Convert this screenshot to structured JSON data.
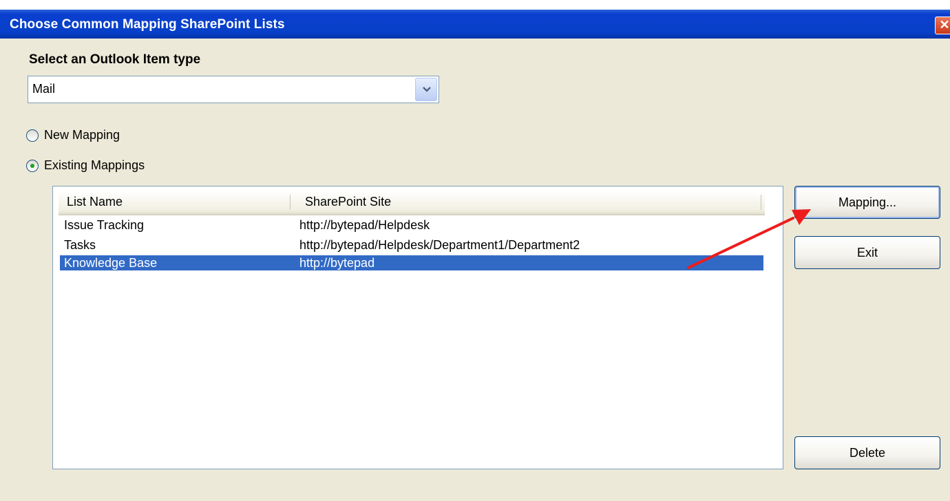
{
  "window": {
    "title": "Choose Common Mapping SharePoint Lists",
    "close_glyph": "✕"
  },
  "item_type": {
    "label": "Select an Outlook Item type",
    "selected": "Mail"
  },
  "radios": {
    "new_mapping": {
      "label": "New Mapping",
      "checked": false
    },
    "existing_mappings": {
      "label": "Existing Mappings",
      "checked": true
    }
  },
  "list": {
    "columns": [
      "List Name",
      "SharePoint Site"
    ],
    "rows": [
      {
        "name": "Issue Tracking",
        "site": "http://bytepad/Helpdesk",
        "selected": false
      },
      {
        "name": "Tasks",
        "site": "http://bytepad/Helpdesk/Department1/Department2",
        "selected": false
      },
      {
        "name": "Knowledge Base",
        "site": "http://bytepad",
        "selected": true
      }
    ]
  },
  "buttons": {
    "mapping": "Mapping...",
    "exit": "Exit",
    "delete": "Delete"
  },
  "colors": {
    "titlebar": "#0a3fcf",
    "selection": "#316ac5",
    "annotation_arrow": "#ee1c1c"
  },
  "icons": {
    "combo": "chevron-down-icon",
    "close": "close-icon",
    "annotation": "red-arrow-annotation"
  }
}
